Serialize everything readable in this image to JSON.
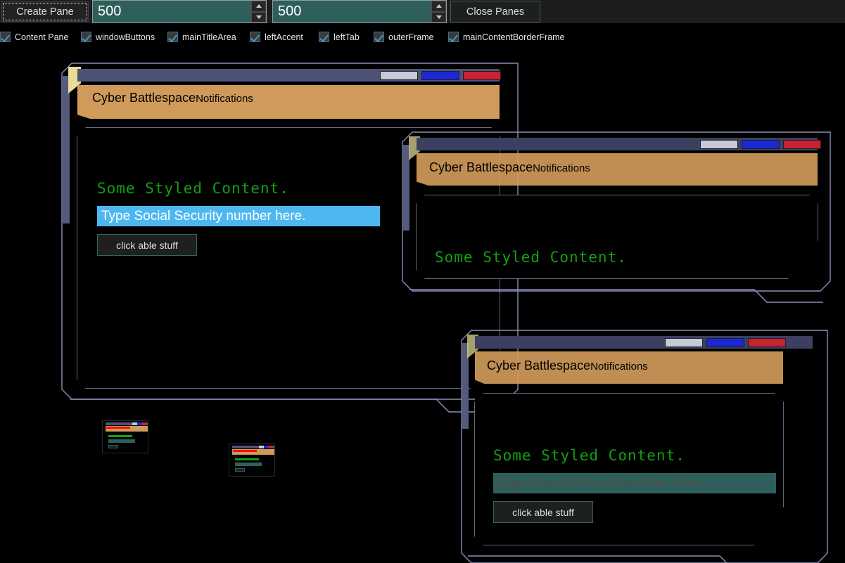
{
  "toolbar": {
    "create_label": "Create Pane",
    "close_label": "Close Panes",
    "width_value": "500",
    "height_value": "500",
    "spinner_up_icon": "chevron-up-icon",
    "spinner_down_icon": "chevron-down-icon"
  },
  "checkboxes": [
    {
      "label": "Content Pane",
      "checked": true
    },
    {
      "label": "windowButtons",
      "checked": true
    },
    {
      "label": "mainTitleArea",
      "checked": true
    },
    {
      "label": "leftAccent",
      "checked": true
    },
    {
      "label": "leftTab",
      "checked": true
    },
    {
      "label": "outerFrame",
      "checked": true
    },
    {
      "label": "mainContentBorderFrame",
      "checked": true
    }
  ],
  "window_buttons": {
    "minimize": "minimize-button",
    "maximize": "maximize-button",
    "close": "close-button"
  },
  "panel_common": {
    "title_main": "Cyber Battlespace",
    "title_sub": "Notifications",
    "content_heading": "Some Styled Content.",
    "input_placeholder": "Type Social Security number here.",
    "button_label": "click able stuff"
  },
  "panels": [
    {
      "id": "panel-1",
      "title_main": "Cyber Battlespace",
      "title_sub": "Notifications",
      "content_heading": "Some Styled Content.",
      "input_placeholder": "Type Social Security number here.",
      "input_value": "",
      "button_label": "click able stuff",
      "focused": true
    },
    {
      "id": "panel-2",
      "title_main": "Cyber Battlespace",
      "title_sub": "Notifications",
      "content_heading": "Some Styled Content.",
      "input_placeholder": "",
      "input_value": "",
      "button_label": "",
      "focused": false
    },
    {
      "id": "panel-3",
      "title_main": "Cyber Battlespace",
      "title_sub": "Notifications",
      "content_heading": "Some Styled Content.",
      "input_placeholder": "Type Social Security number here.",
      "input_value": "",
      "button_label": "click able stuff",
      "focused": false
    }
  ],
  "colors": {
    "title_bar": "#4e5277",
    "title_area": "#d09a5a",
    "left_tab": "#e8dc96",
    "left_accent": "#565a7d",
    "frame_stroke": "#8a8fb8",
    "heading_green": "#12a012",
    "title_red": "#fb0d0d",
    "title_green": "#1a8f1a",
    "input_focus": "#4db8f0",
    "input_blur": "#2f5f5c",
    "btn_min": "#c6cad4",
    "btn_max": "#1c28d4",
    "btn_close": "#c8232f",
    "background": "#000000"
  }
}
